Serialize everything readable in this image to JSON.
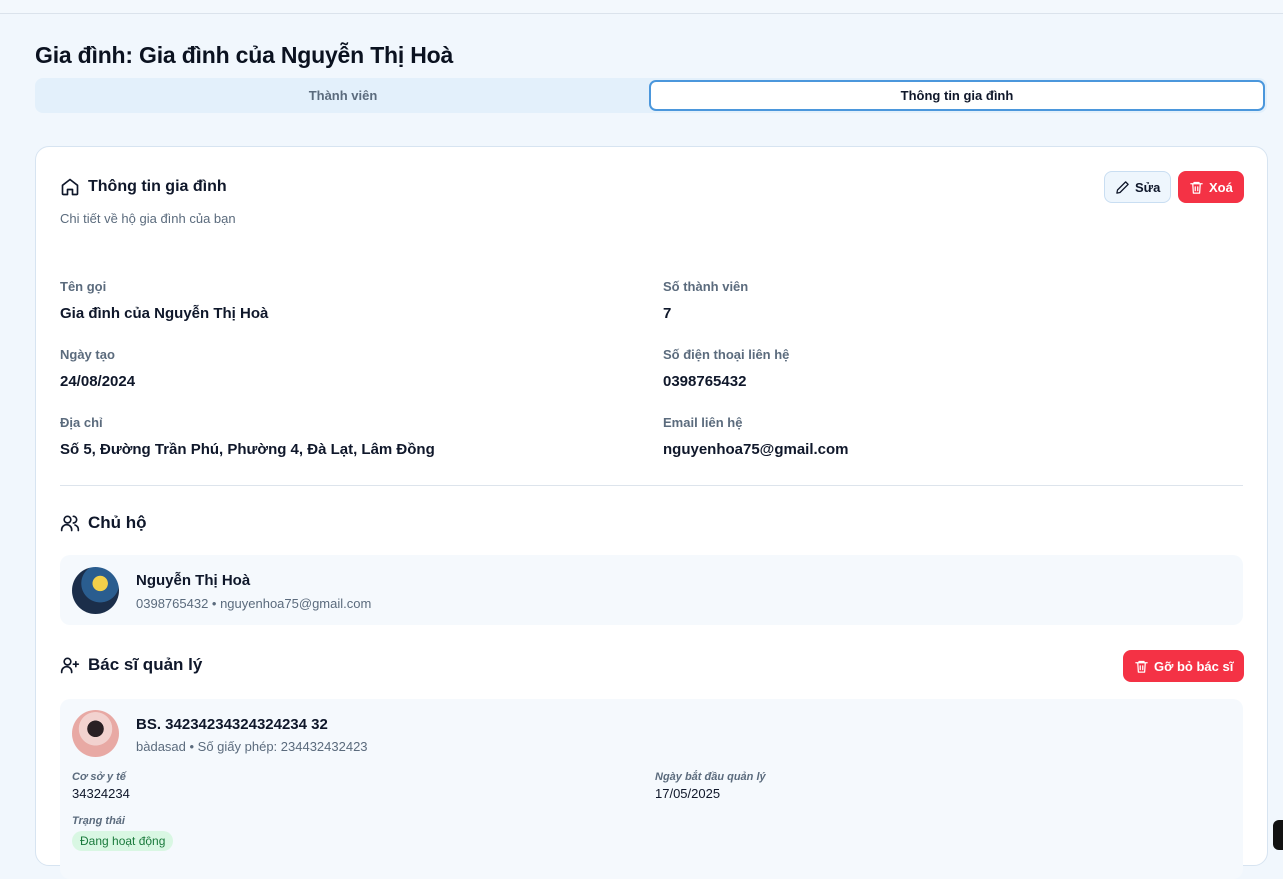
{
  "page": {
    "title": "Gia đình: Gia đình của Nguyễn Thị Hoà"
  },
  "tabs": {
    "members": "Thành viên",
    "info": "Thông tin gia đình"
  },
  "info_section": {
    "title": "Thông tin gia đình",
    "subtitle": "Chi tiết về hộ gia đình của bạn",
    "edit_label": "Sửa",
    "delete_label": "Xoá"
  },
  "fields": {
    "name_label": "Tên gọi",
    "name_value": "Gia đình của Nguyễn Thị Hoà",
    "members_label": "Số thành viên",
    "members_value": "7",
    "created_label": "Ngày tạo",
    "created_value": "24/08/2024",
    "phone_label": "Số điện thoại liên hệ",
    "phone_value": "0398765432",
    "address_label": "Địa chỉ",
    "address_value": "Số 5, Đường Trần Phú, Phường 4, Đà Lạt, Lâm Đồng",
    "email_label": "Email liên hệ",
    "email_value": "nguyenhoa75@gmail.com"
  },
  "owner": {
    "title": "Chủ hộ",
    "name": "Nguyễn Thị Hoà",
    "meta": "0398765432 • nguyenhoa75@gmail.com"
  },
  "doctor": {
    "title": "Bác sĩ quản lý",
    "remove_label": "Gỡ bỏ bác sĩ",
    "name": "BS. 34234234324324234 32",
    "meta": "bàdasad • Số giấy phép: 234432432423",
    "facility_label": "Cơ sở y tế",
    "facility_value": "34324234",
    "start_label": "Ngày bắt đầu quản lý",
    "start_value": "17/05/2025",
    "status_label": "Trạng thái",
    "status_value": "Đang hoạt động"
  },
  "colors": {
    "accent": "#4b97dc",
    "danger": "#f43245",
    "active_badge": "#d9f7e3"
  }
}
